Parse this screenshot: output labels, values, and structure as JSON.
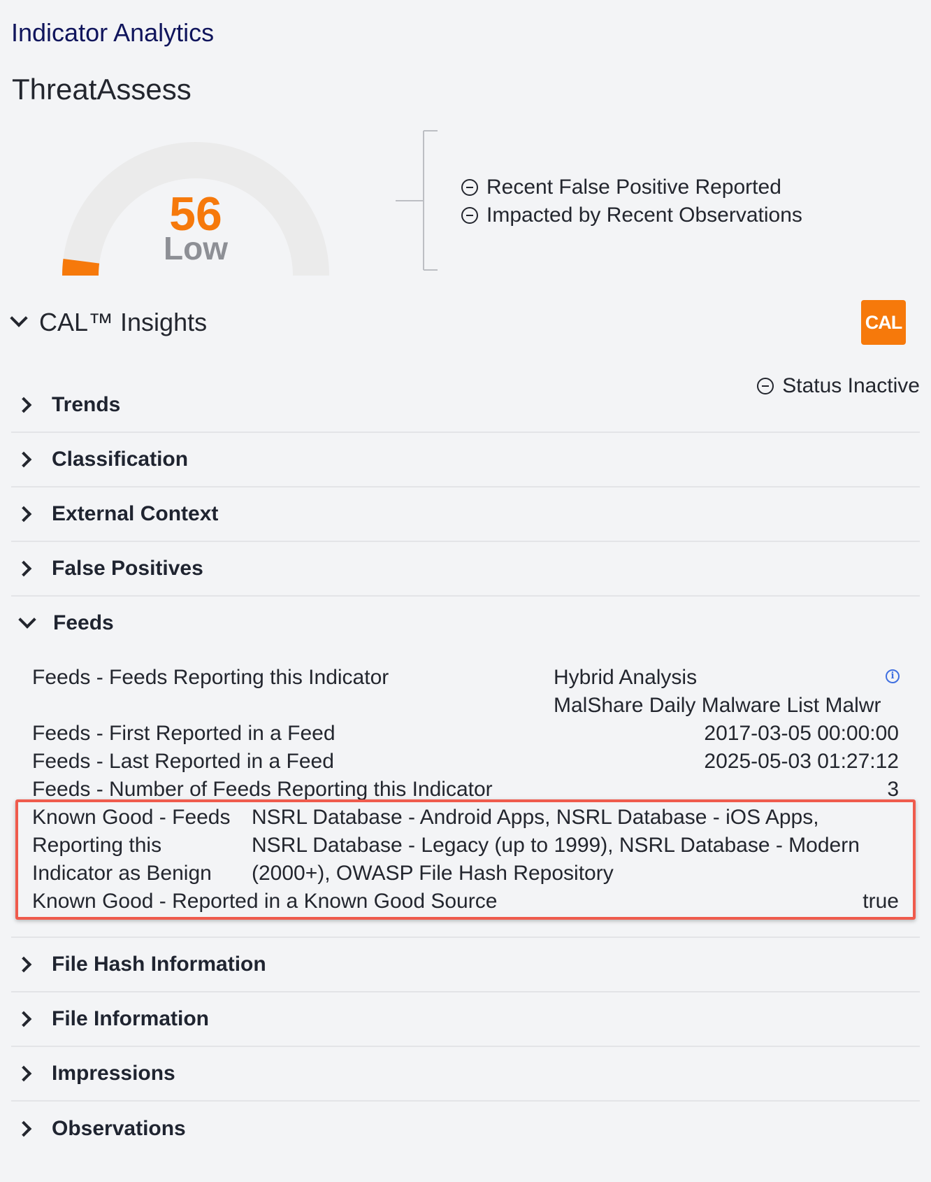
{
  "header": {
    "app_title": "Indicator Analytics",
    "section_title": "ThreatAssess"
  },
  "gauge": {
    "score": "56",
    "level": "Low",
    "score_fraction": 0.56,
    "color": "#f6790b",
    "track_color": "#ebebeb"
  },
  "factors": [
    {
      "icon": "minus-circle-icon",
      "label": "Recent False Positive Reported"
    },
    {
      "icon": "minus-circle-icon",
      "label": "Impacted by Recent Observations"
    }
  ],
  "cal": {
    "title": "CAL™ Insights",
    "logo_text": "CAL",
    "logo_color": "#f6790b",
    "status": "Status Inactive"
  },
  "sections_top": [
    "Trends",
    "Classification",
    "External Context",
    "False Positives"
  ],
  "feeds": {
    "title": "Feeds",
    "rows": {
      "reporting_label": "Feeds - Feeds Reporting this Indicator",
      "reporting_values": [
        "Hybrid Analysis",
        "MalShare Daily Malware List Malwr"
      ],
      "first_label": "Feeds - First Reported in a Feed",
      "first_value": "2017-03-05 00:00:00",
      "last_label": "Feeds - Last Reported in a Feed",
      "last_value": "2025-05-03 01:27:12",
      "count_label": "Feeds - Number of Feeds Reporting this Indicator",
      "count_value": "3"
    },
    "known_good": {
      "feeds_label_lines": [
        "Known Good - Feeds",
        "Reporting this",
        "Indicator as Benign"
      ],
      "feeds_value_lines": [
        "NSRL Database - Android Apps, NSRL Database - iOS Apps,",
        "NSRL Database - Legacy (up to 1999), NSRL Database - Modern",
        "(2000+), OWASP File Hash Repository"
      ],
      "source_label": "Known Good - Reported in a Known Good Source",
      "source_value": "true"
    },
    "highlight_color": "#ef5b4d"
  },
  "sections_bottom": [
    "File Hash Information",
    "File Information",
    "Impressions",
    "Observations"
  ]
}
